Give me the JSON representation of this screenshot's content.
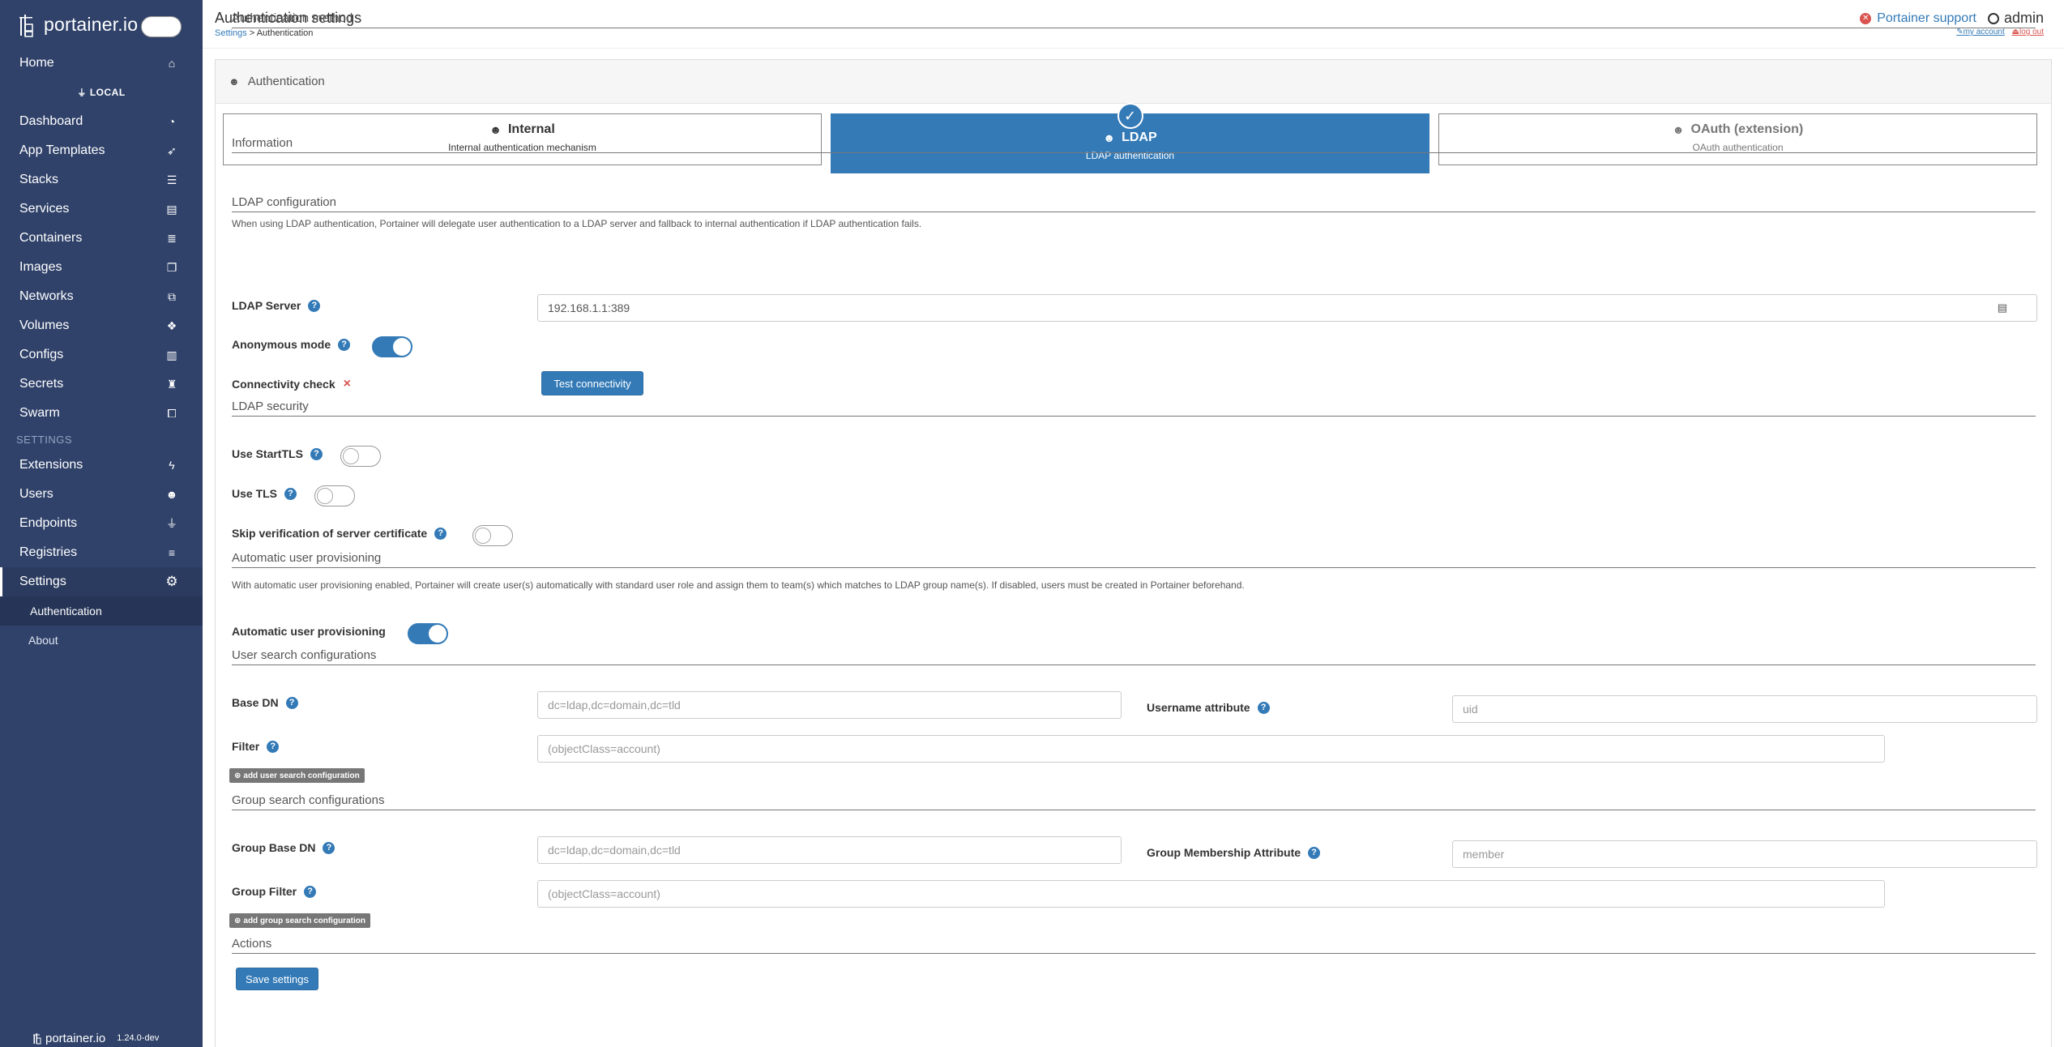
{
  "sidebar": {
    "brand": "portainer.io",
    "endpoint_label": "LOCAL",
    "items_top": [
      {
        "label": "Home",
        "icon": "home-icon",
        "glyph": "⌂"
      }
    ],
    "items": [
      {
        "label": "Dashboard",
        "icon": "dashboard-icon",
        "glyph": "◔"
      },
      {
        "label": "App Templates",
        "icon": "rocket-icon",
        "glyph": "➶"
      },
      {
        "label": "Stacks",
        "icon": "list-icon",
        "glyph": "☰"
      },
      {
        "label": "Services",
        "icon": "services-icon",
        "glyph": "▤"
      },
      {
        "label": "Containers",
        "icon": "containers-icon",
        "glyph": "≣"
      },
      {
        "label": "Images",
        "icon": "images-icon",
        "glyph": "❐"
      },
      {
        "label": "Networks",
        "icon": "sitemap-icon",
        "glyph": "⧉"
      },
      {
        "label": "Volumes",
        "icon": "cubes-icon",
        "glyph": "❖"
      },
      {
        "label": "Configs",
        "icon": "file-code-icon",
        "glyph": "▥"
      },
      {
        "label": "Secrets",
        "icon": "user-secret-icon",
        "glyph": "♜"
      },
      {
        "label": "Swarm",
        "icon": "object-group-icon",
        "glyph": "⧠"
      }
    ],
    "settings_heading": "SETTINGS",
    "settings_items": [
      {
        "label": "Extensions",
        "icon": "bolt-icon",
        "glyph": "ϟ"
      },
      {
        "label": "Users",
        "icon": "users-icon",
        "glyph": "☻"
      },
      {
        "label": "Endpoints",
        "icon": "plug-icon",
        "glyph": "⏚"
      },
      {
        "label": "Registries",
        "icon": "database-icon",
        "glyph": "≡"
      }
    ],
    "settings_label": "Settings",
    "settings_icon_glyph": "⚙",
    "sub_authentication": "Authentication",
    "sub_about": "About",
    "footer_brand": "portainer.io",
    "version": "1.24.0-dev"
  },
  "header": {
    "title": "Authentication settings",
    "crumb_settings": "Settings",
    "crumb_sep": " > ",
    "crumb_current": "Authentication",
    "support_label": "Portainer support",
    "username": "admin",
    "my_account": "my account",
    "log_out": "log out"
  },
  "panel": {
    "title": "Authentication",
    "method_section": "Authentication method",
    "methods": [
      {
        "title": "Internal",
        "desc": "Internal authentication mechanism"
      },
      {
        "title": "LDAP",
        "desc": "LDAP authentication"
      },
      {
        "title": "OAuth (extension)",
        "desc": "OAuth authentication"
      }
    ],
    "info_section": "Information",
    "info_text": "When using LDAP authentication, Portainer will delegate user authentication to a LDAP server and fallback to internal authentication if LDAP authentication fails.",
    "ldap_config_section": "LDAP configuration",
    "ldap_server_label": "LDAP Server",
    "ldap_server_value": "192.168.1.1:389",
    "anonymous_label": "Anonymous mode",
    "anonymous_on": true,
    "connectivity_label": "Connectivity check",
    "connectivity_status": "×",
    "test_button": "Test connectivity",
    "ldap_security_section": "LDAP security",
    "starttls_label": "Use StartTLS",
    "tls_label": "Use TLS",
    "skip_verify_label": "Skip verification of server certificate",
    "auto_prov_section": "Automatic user provisioning",
    "auto_prov_text": "With automatic user provisioning enabled, Portainer will create user(s) automatically with standard user role and assign them to team(s) which matches to LDAP group name(s). If disabled, users must be created in Portainer beforehand.",
    "auto_prov_label": "Automatic user provisioning",
    "auto_prov_on": true,
    "user_search_section": "User search configurations",
    "base_dn_label": "Base DN",
    "base_dn_placeholder": "dc=ldap,dc=domain,dc=tld",
    "username_attr_label": "Username attribute",
    "username_attr_placeholder": "uid",
    "filter_label": "Filter",
    "filter_placeholder": "(objectClass=account)",
    "add_user_search": "add user search configuration",
    "group_search_section": "Group search configurations",
    "group_base_dn_label": "Group Base DN",
    "group_base_dn_placeholder": "dc=ldap,dc=domain,dc=tld",
    "group_member_attr_label": "Group Membership Attribute",
    "group_member_attr_placeholder": "member",
    "group_filter_label": "Group Filter",
    "group_filter_placeholder": "(objectClass=account)",
    "add_group_search": "add group search configuration",
    "actions_section": "Actions",
    "save_button": "Save settings"
  },
  "colors": {
    "sidebar_bg": "#30426a",
    "primary": "#337ab7",
    "danger": "#d9534f"
  }
}
